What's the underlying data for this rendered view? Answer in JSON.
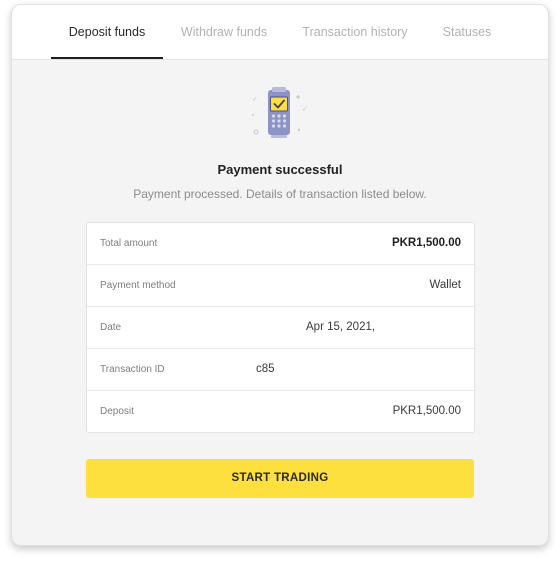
{
  "tabs": [
    {
      "label": "Deposit funds",
      "active": true
    },
    {
      "label": "Withdraw funds",
      "active": false
    },
    {
      "label": "Transaction history",
      "active": false
    },
    {
      "label": "Statuses",
      "active": false
    }
  ],
  "illustration": {
    "icon": "payment-terminal-check-icon",
    "accent": "#fddf3d"
  },
  "status": {
    "title": "Payment successful",
    "subtitle": "Payment processed. Details of transaction listed below."
  },
  "details": [
    {
      "label": "Total amount",
      "value": "PKR1,500.00"
    },
    {
      "label": "Payment method",
      "value": "Wallet"
    },
    {
      "label": "Date",
      "value": "Apr 15, 2021,"
    },
    {
      "label": "Transaction ID",
      "value": "c85"
    },
    {
      "label": "Deposit",
      "value": "PKR1,500.00"
    }
  ],
  "action": {
    "label": "START TRADING",
    "color": "#fddf3d"
  }
}
